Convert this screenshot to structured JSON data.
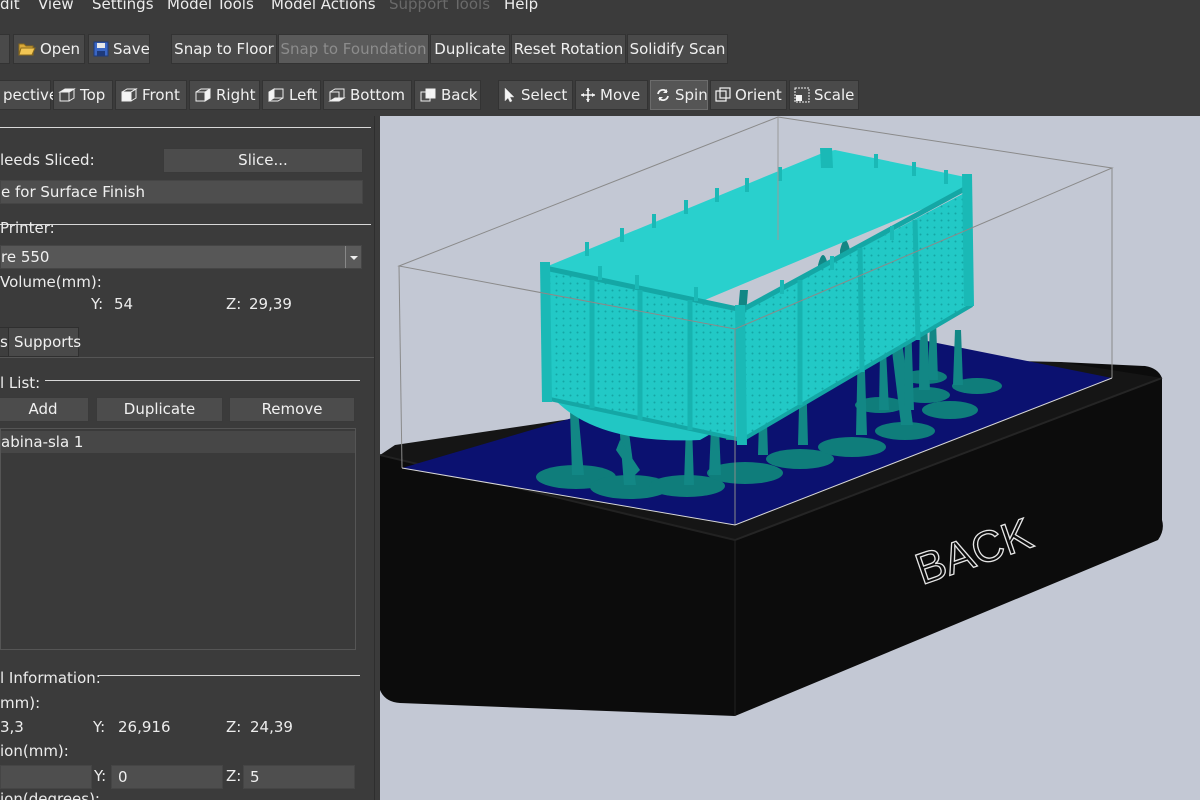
{
  "menu": {
    "items": [
      {
        "label": "dit",
        "disabled": false
      },
      {
        "label": "View",
        "disabled": false
      },
      {
        "label": "Settings",
        "disabled": false
      },
      {
        "label": "Model Tools",
        "disabled": false
      },
      {
        "label": "Model Actions",
        "disabled": false
      },
      {
        "label": "Support Tools",
        "disabled": true
      },
      {
        "label": "Help",
        "disabled": false
      }
    ]
  },
  "toolbar_main": {
    "open": "Open",
    "save": "Save",
    "snap_floor": "Snap to Floor",
    "snap_foundation": "Snap to Foundation",
    "duplicate": "Duplicate",
    "reset_rotation": "Reset Rotation",
    "solidify_scan": "Solidify Scan"
  },
  "toolbar_view": {
    "perspective": "pective",
    "top": "Top",
    "front": "Front",
    "right": "Right",
    "left": "Left",
    "bottom": "Bottom",
    "back": "Back",
    "select": "Select",
    "move": "Move",
    "spin": "Spin",
    "orient": "Orient",
    "scale": "Scale"
  },
  "panel": {
    "needs_sliced": "leeds Sliced:",
    "slice_button": "Slice...",
    "surface_finish": "e for Surface Finish",
    "printer_label": "Printer:",
    "printer_value": "re 550",
    "volume_label": "Volume(mm):",
    "volume_y_label": "Y:",
    "volume_y": "54",
    "volume_z_label": "Z:",
    "volume_z": "29,39",
    "tab_models": "s",
    "tab_supports": "Supports",
    "model_list_label": "l List:",
    "add_button": "Add",
    "duplicate_button": "Duplicate",
    "remove_button": "Remove",
    "model_item": "abina-sla 1",
    "model_info_label": "l Information:",
    "size_label": "mm):",
    "size_x": "3,3",
    "size_y_label": "Y:",
    "size_y": "26,916",
    "size_z_label": "Z:",
    "size_z": "24,39",
    "position_label": "ion(mm):",
    "pos_y_label": "Y:",
    "pos_y": "0",
    "pos_z_label": "Z:",
    "pos_z": "5",
    "rotation_label": "ion(degrees):"
  },
  "viewport": {
    "base_label": "BACK"
  },
  "colors": {
    "model": "#1fc8c6",
    "supports": "#12807e",
    "build_plate": "#0b1170",
    "machine_base": "#0a0a0a",
    "viewport_bg": "#c3c8d4"
  }
}
